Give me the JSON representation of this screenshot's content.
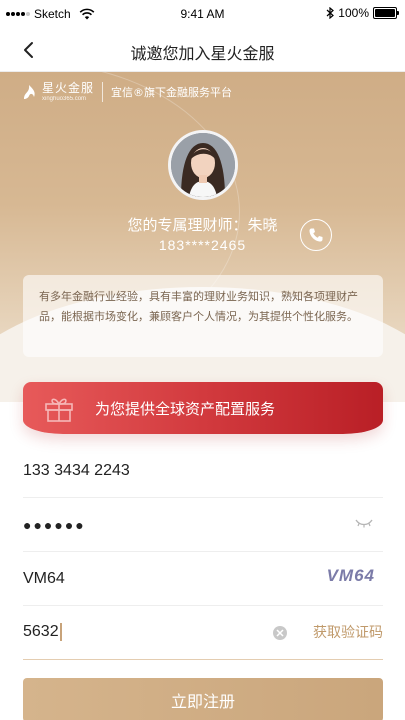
{
  "status_bar": {
    "carrier": "Sketch",
    "time": "9:41 AM",
    "battery": "100%"
  },
  "nav": {
    "title": "诚邀您加入星火金服"
  },
  "brand": {
    "name": "星火金服",
    "url": "xinghuo365.com",
    "tagline": "宜信®旗下金融服务平台"
  },
  "advisor": {
    "label": "您的专属理财师：朱晓",
    "phone": "183****2465",
    "intro": "有多年金融行业经验，具有丰富的理财业务知识，熟知各项理财产品，能根据市场变化，兼顾客户个人情况，为其提供个性化服务。"
  },
  "promo": {
    "text": "为您提供全球资产配置服务"
  },
  "form": {
    "phone_value": "133 3434 2243",
    "password_value": "●●●●●●",
    "captcha_input_value": "VM64",
    "captcha_image_text": "VM64",
    "sms_code_value": "5632",
    "get_code_label": "获取验证码"
  },
  "register": {
    "label": "立即注册"
  },
  "colors": {
    "gold": "#c8a37a",
    "promo_red": "#d23a3e",
    "captcha_purple": "#7b7ba8"
  },
  "icons": [
    "wifi-icon",
    "bluetooth-icon",
    "battery-icon",
    "back-arrow-icon",
    "phone-icon",
    "gift-icon",
    "eye-closed-icon",
    "clear-icon"
  ]
}
